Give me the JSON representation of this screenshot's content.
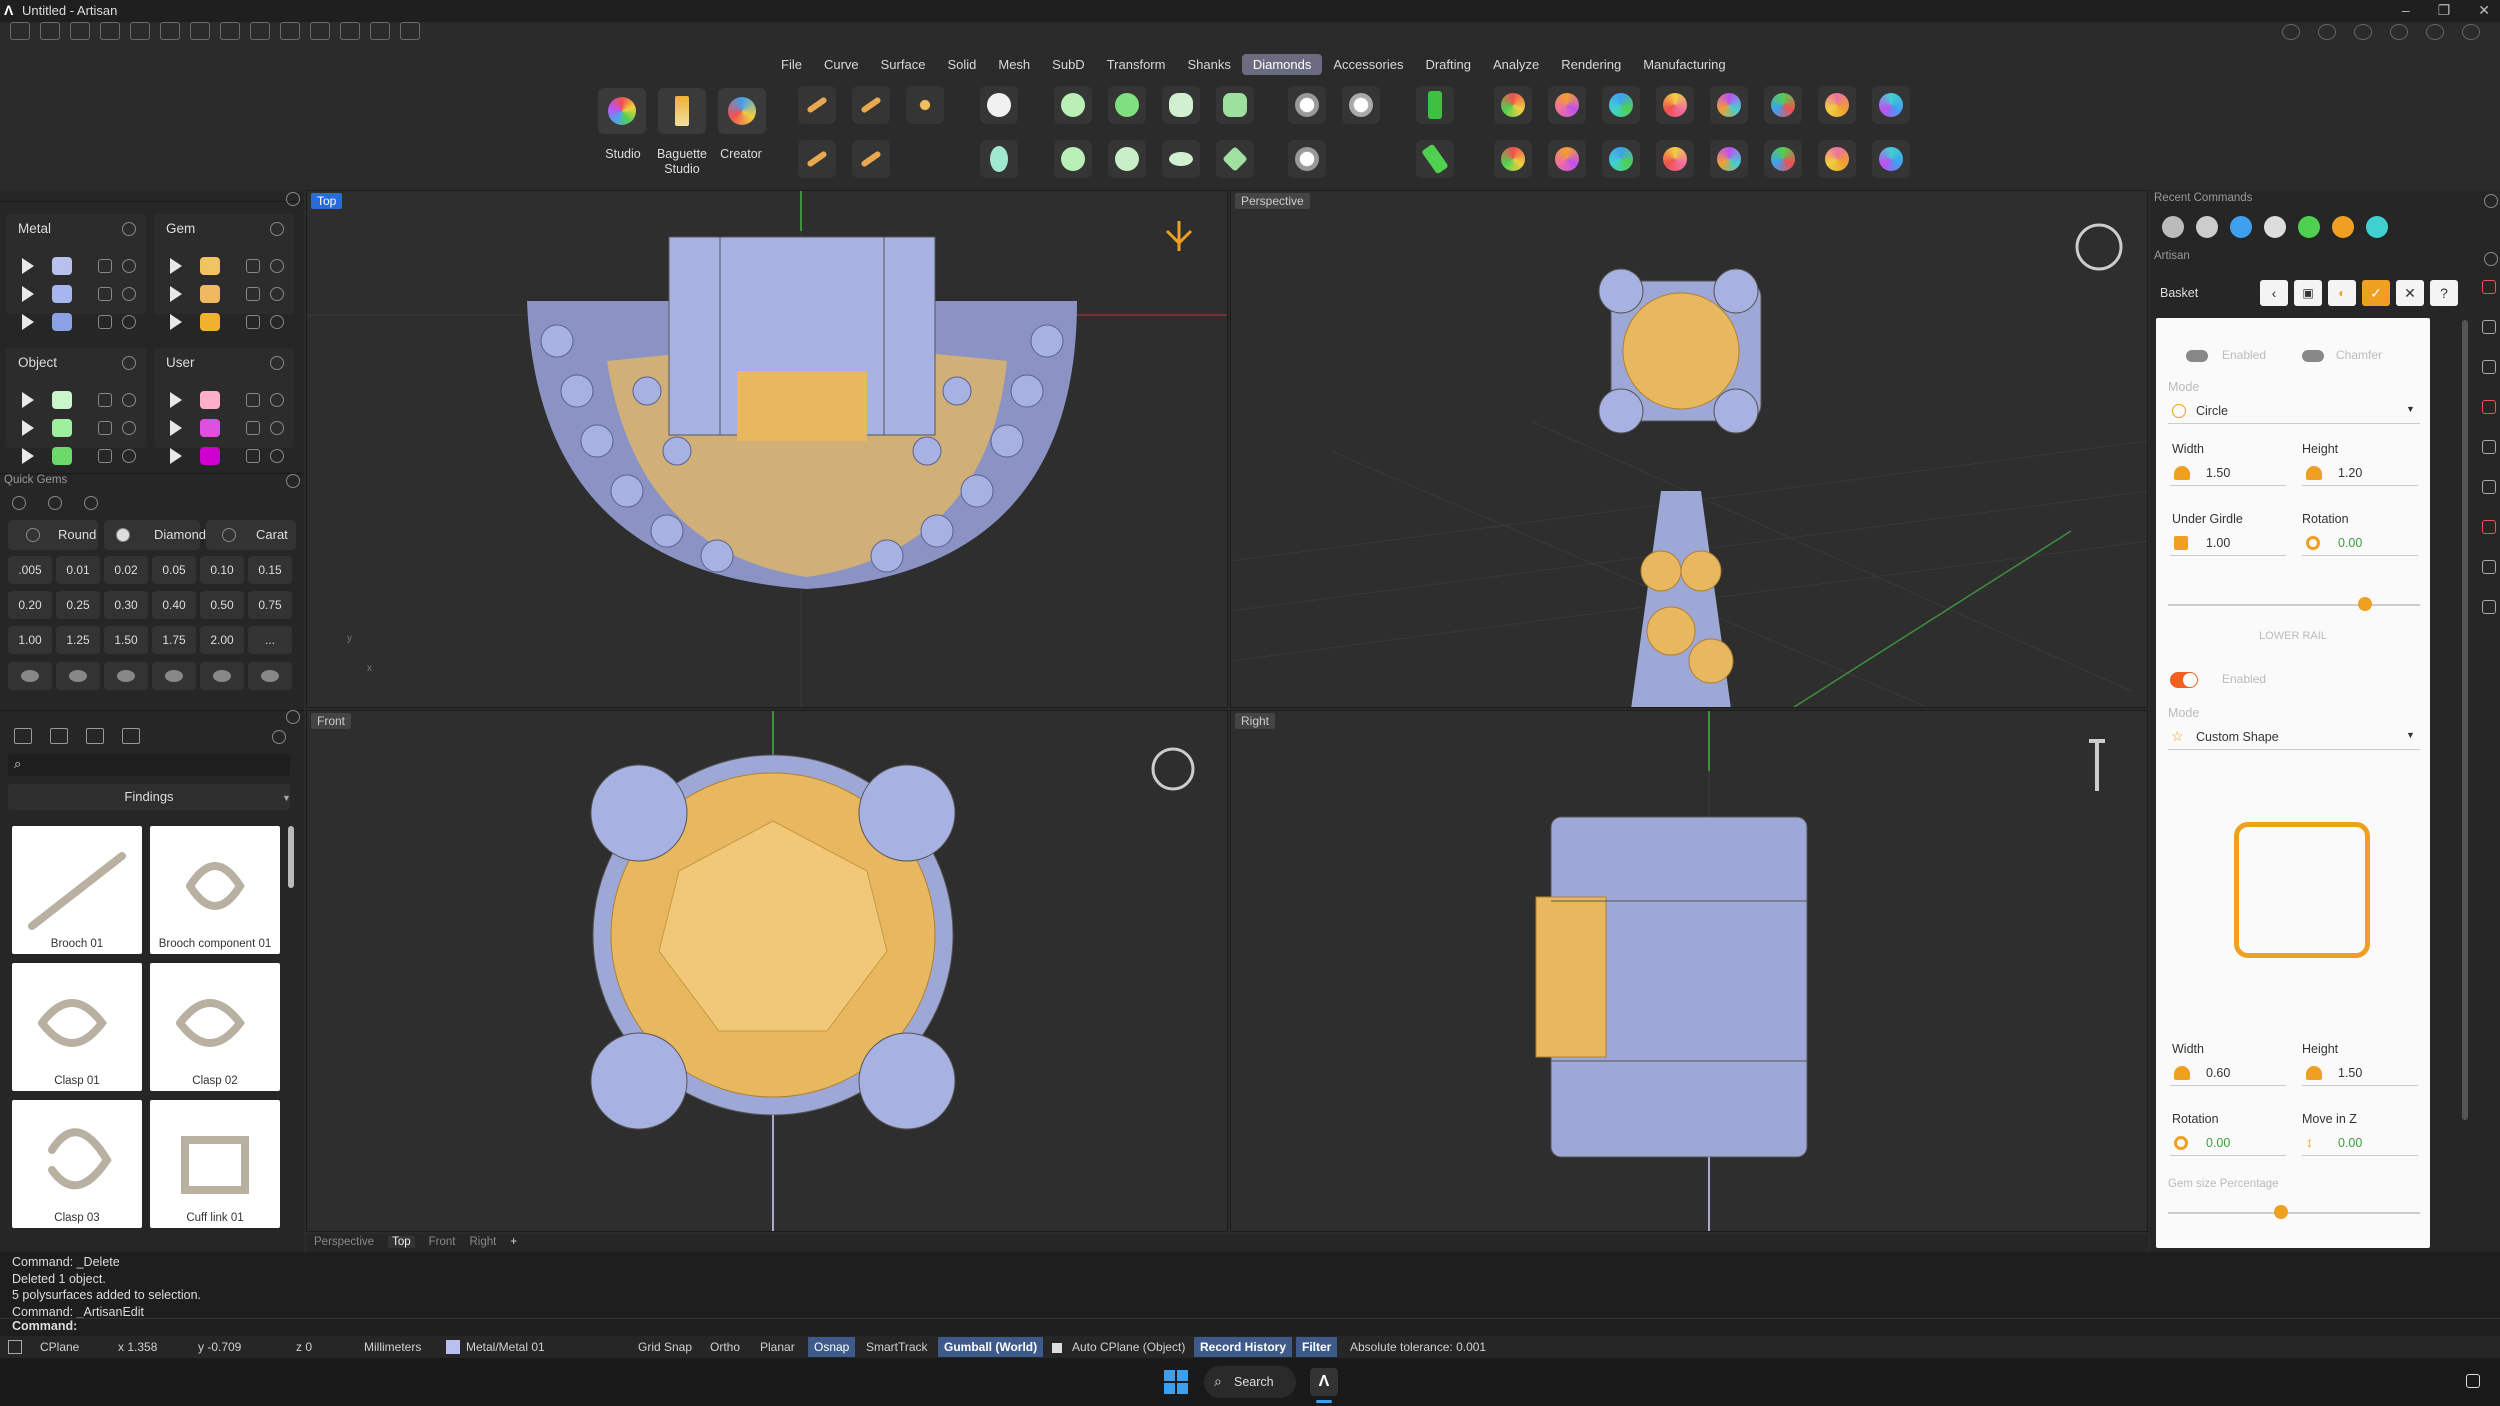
{
  "window": {
    "title": "Untitled - Artisan"
  },
  "menu": [
    "File",
    "Curve",
    "Surface",
    "Solid",
    "Mesh",
    "SubD",
    "Transform",
    "Shanks",
    "Diamonds",
    "Accessories",
    "Drafting",
    "Analyze",
    "Rendering",
    "Manufacturing"
  ],
  "menu_active": "Diamonds",
  "ribbon": {
    "studio": "Studio",
    "baguette_1": "Baguette",
    "baguette_2": "Studio",
    "creator": "Creator"
  },
  "left": {
    "metal": "Metal",
    "gem": "Gem",
    "object": "Object",
    "user": "User",
    "quick_gems": "Quick Gems",
    "round": "Round",
    "diamond": "Diamond",
    "carat": "Carat",
    "sizes": [
      ".005",
      "0.01",
      "0.02",
      "0.05",
      "0.10",
      "0.15",
      "0.20",
      "0.25",
      "0.30",
      "0.40",
      "0.50",
      "0.75",
      "1.00",
      "1.25",
      "1.50",
      "1.75",
      "2.00",
      "..."
    ],
    "findings": "Findings",
    "items": [
      "Brooch 01",
      "Brooch component 01",
      "Clasp 01",
      "Clasp 02",
      "Clasp 03",
      "Cuff link 01"
    ],
    "colors": {
      "metal": [
        "#b8c0ee",
        "#a6b6ee",
        "#8aa2e4"
      ],
      "gem": [
        "#f0c460",
        "#f0b860",
        "#f0b030"
      ],
      "object": [
        "#c9f7c9",
        "#9ef09e",
        "#6cd86c"
      ],
      "user": [
        "#ffb0c8",
        "#e050e0",
        "#d000d0"
      ]
    }
  },
  "viewports": {
    "top": "Top",
    "perspective": "Perspective",
    "front": "Front",
    "right": "Right"
  },
  "viewport_tabs": [
    "Perspective",
    "Top",
    "Front",
    "Right"
  ],
  "right": {
    "recent_commands": "Recent Commands",
    "artisan": "Artisan",
    "basket": "Basket",
    "enabled": "Enabled",
    "chamfer": "Chamfer",
    "mode": "Mode",
    "mode_value": "Circle",
    "width": "Width",
    "width_value": "1.50",
    "height": "Height",
    "height_value": "1.20",
    "under_girdle": "Under Girdle",
    "under_girdle_value": "1.00",
    "rotation": "Rotation",
    "rotation_value": "0.00",
    "lower_rail": "LOWER RAIL",
    "enabled2": "Enabled",
    "mode2": "Mode",
    "mode2_value": "Custom Shape",
    "width2": "Width",
    "width2_value": "0.60",
    "height2": "Height",
    "height2_value": "1.50",
    "rotation2": "Rotation",
    "rotation2_value": "0.00",
    "move_z": "Move in Z",
    "move_z_value": "0.00",
    "gem_size_pct": "Gem size Percentage",
    "slider1": 0.78,
    "slider2": 0.45
  },
  "command_history": [
    "Command: _Delete",
    "Deleted 1 object.",
    "5 polysurfaces added to selection.",
    "Command: _ArtisanEdit"
  ],
  "command_prompt": "Command:",
  "status": {
    "cplane": "CPlane",
    "x": "x 1.358",
    "y": "y -0.709",
    "z": "z 0",
    "units": "Millimeters",
    "layer": "Metal/Metal 01",
    "grid_snap": "Grid Snap",
    "ortho": "Ortho",
    "planar": "Planar",
    "osnap": "Osnap",
    "smarttrack": "SmartTrack",
    "gumball": "Gumball (World)",
    "auto_cplane": "Auto CPlane (Object)",
    "record_history": "Record History",
    "filter": "Filter",
    "tolerance": "Absolute tolerance: 0.001"
  },
  "taskbar": {
    "search": "Search"
  },
  "colors": {
    "accent": "#f0a020",
    "metal": "#9ea8d6",
    "gem": "#e8b860",
    "osnap": "#3d5a8a"
  }
}
